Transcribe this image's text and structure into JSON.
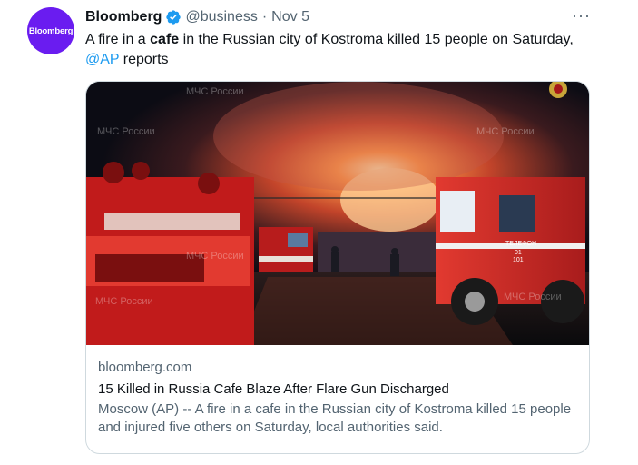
{
  "tweet": {
    "avatar_text": "Bloomberg",
    "author_name": "Bloomberg",
    "handle": "@business",
    "separator": "·",
    "date": "Nov 5",
    "more_icon": "···",
    "text_part1": "A fire in a ",
    "text_bold": "cafe",
    "text_part2": " in the Russian city of Kostroma killed 15 people on Saturday,",
    "mention": "@AP",
    "text_part3": " reports"
  },
  "card": {
    "domain": "bloomberg.com",
    "title": "15 Killed in Russia Cafe Blaze After Flare Gun Discharged",
    "description": "Moscow (AP) -- A fire in a cafe in the Russian city of Kostroma killed 15 people and injured five others on Saturday, local authorities said.",
    "image_watermark": "МЧС России",
    "truck_text_line1": "ТЕЛЕФОН",
    "truck_text_line2": "01",
    "truck_text_line3": "101"
  },
  "colors": {
    "brand_avatar": "#6a1cf0",
    "verified_badge": "#1d9bf0",
    "mention": "#1d9bf0",
    "secondary_text": "#536471",
    "border": "#cfd9de"
  },
  "icons": {
    "verified": "verified-badge-icon",
    "more": "more-options-icon"
  }
}
